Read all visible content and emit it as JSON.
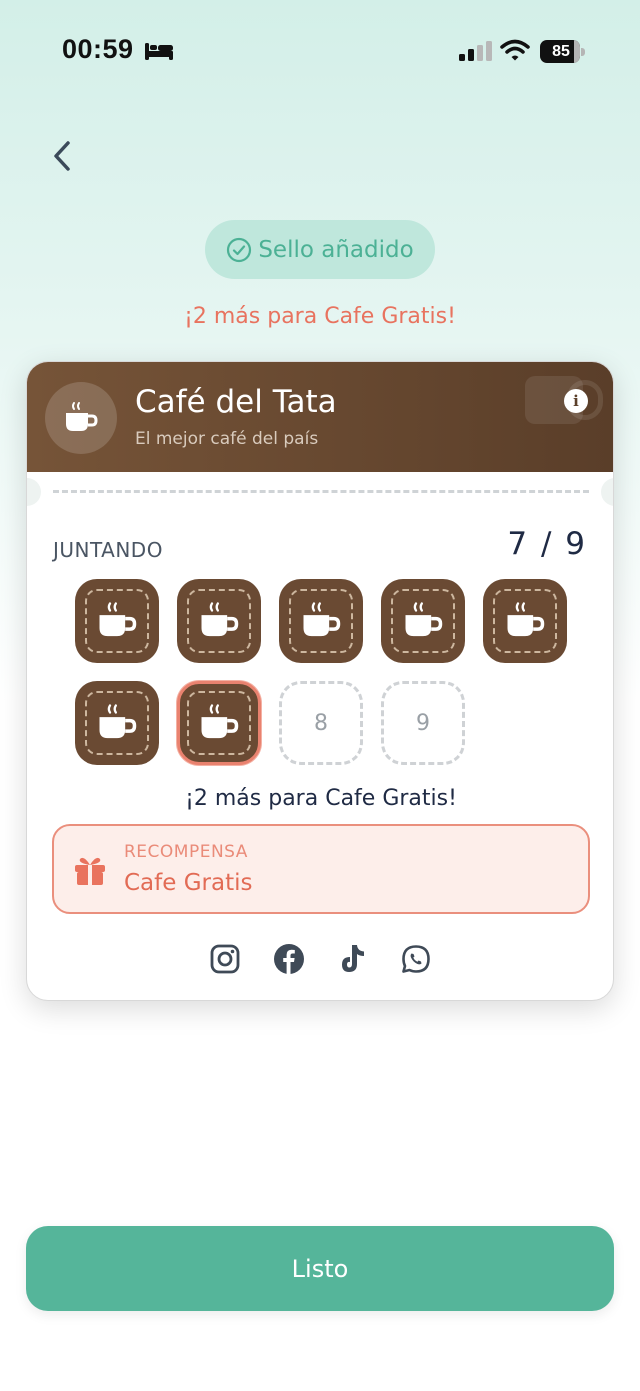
{
  "status_bar": {
    "time": "00:59",
    "battery": "85"
  },
  "banner": {
    "stamp_added": "Sello añadido",
    "remaining": "¡2 más para Cafe Gratis!"
  },
  "card": {
    "shop_name": "Café del Tata",
    "tagline": "El mejor café del país",
    "info_icon": "i",
    "collect_label": "JUNTANDO",
    "count": "7 / 9",
    "stamps": [
      {
        "state": "filled"
      },
      {
        "state": "filled"
      },
      {
        "state": "filled"
      },
      {
        "state": "filled"
      },
      {
        "state": "filled"
      },
      {
        "state": "filled"
      },
      {
        "state": "latest"
      },
      {
        "state": "empty",
        "number": "8"
      },
      {
        "state": "empty",
        "number": "9"
      }
    ],
    "remaining": "¡2 más para Cafe Gratis!",
    "reward": {
      "label": "RECOMPENSA",
      "name": "Cafe Gratis"
    },
    "social_icons": [
      "instagram-icon",
      "facebook-icon",
      "tiktok-icon",
      "whatsapp-icon"
    ]
  },
  "done_button": "Listo",
  "colors": {
    "accent": "#55b59a",
    "coffee": "#6a4a33",
    "reward": "#e26b55"
  }
}
